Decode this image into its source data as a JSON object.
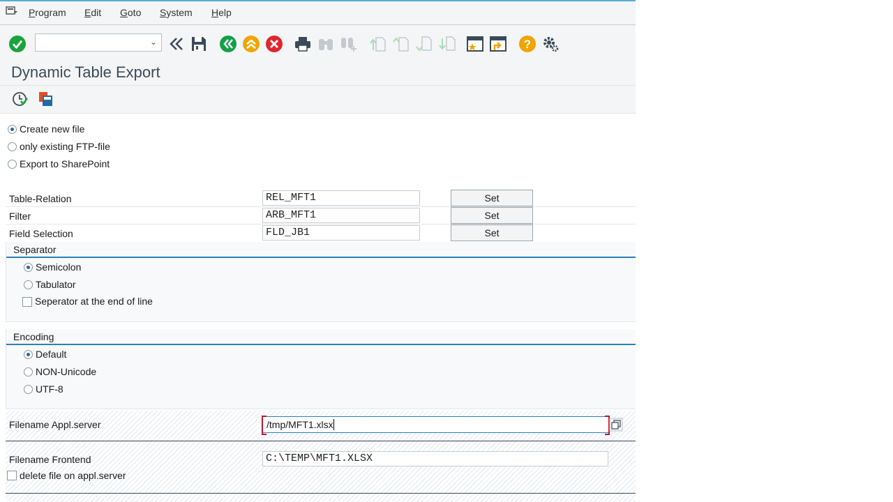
{
  "menu": {
    "items": [
      "Program",
      "Edit",
      "Goto",
      "System",
      "Help"
    ],
    "underline": [
      "P",
      "E",
      "G",
      "S",
      "H"
    ]
  },
  "toolbar": {
    "command_field_value": "",
    "icons": [
      "enter-icon",
      "back-double-icon",
      "save-icon",
      "back-icon",
      "exit-icon",
      "cancel-icon",
      "print-icon",
      "find-icon",
      "find-next-icon",
      "first-page-icon",
      "previous-page-icon",
      "next-page-icon",
      "last-page-icon",
      "create-session-icon",
      "shortcut-icon",
      "help-icon",
      "customize-icon"
    ]
  },
  "page": {
    "title": "Dynamic Table Export"
  },
  "app_toolbar": {
    "icons": [
      "execute-icon",
      "variants-icon"
    ]
  },
  "file_mode": {
    "options": [
      {
        "label": "Create new file",
        "selected": true
      },
      {
        "label": "only existing FTP-file",
        "selected": false
      },
      {
        "label": "Export to SharePoint",
        "selected": false
      }
    ]
  },
  "params": {
    "rows": [
      {
        "label": "Table-Relation",
        "value": "REL_MFT1",
        "button": "Set"
      },
      {
        "label": "Filter",
        "value": "ARB_MFT1",
        "button": "Set"
      },
      {
        "label": "Field Selection",
        "value": "FLD_JB1",
        "button": "Set"
      }
    ]
  },
  "separator": {
    "title": "Separator",
    "options": [
      {
        "label": "Semicolon",
        "selected": true
      },
      {
        "label": "Tabulator",
        "selected": false
      }
    ],
    "checkbox": {
      "label": "Seperator at the end of line",
      "checked": false
    }
  },
  "encoding": {
    "title": "Encoding",
    "options": [
      {
        "label": "Default",
        "selected": true
      },
      {
        "label": "NON-Unicode",
        "selected": false
      },
      {
        "label": "UTF-8",
        "selected": false
      }
    ]
  },
  "files": {
    "appl_label": "Filename Appl.server",
    "appl_value": "/tmp/MFT1.xlsx",
    "frontend_label": "Filename Frontend",
    "frontend_value": "C:\\TEMP\\MFT1.XLSX",
    "delete_label": "delete file on appl.server",
    "delete_checked": false
  },
  "colors": {
    "accent_blue": "#2c7fb8",
    "ok_green": "#1aa33a",
    "nav_green": "#13a049",
    "nav_orange": "#f0a500",
    "cancel_red": "#e0262e"
  }
}
